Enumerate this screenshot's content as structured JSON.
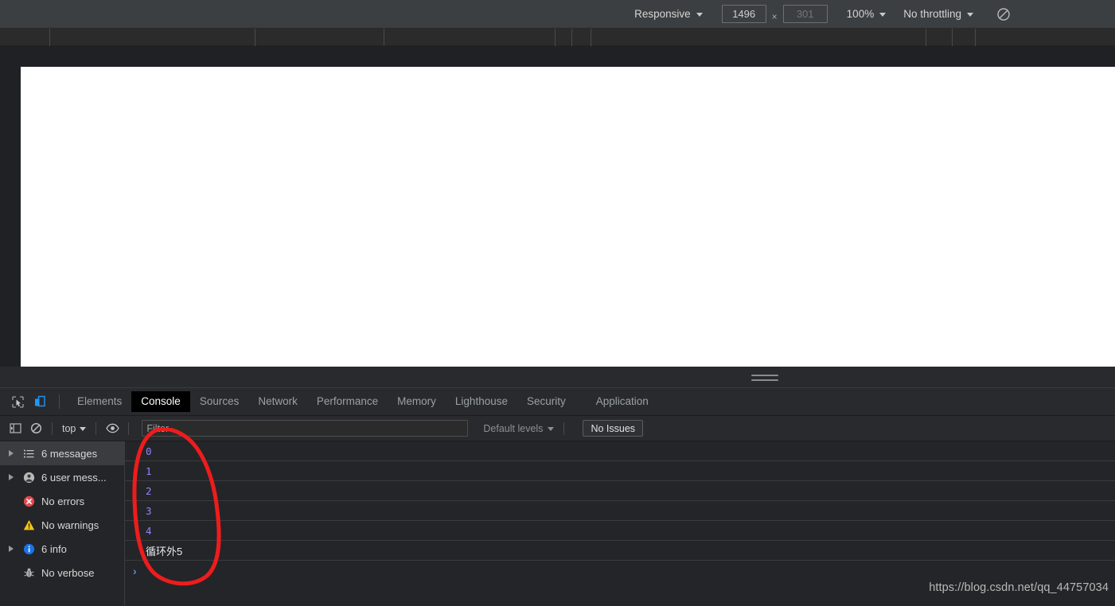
{
  "device_toolbar": {
    "device_select": "Responsive",
    "width_value": "1496",
    "height_placeholder": "301",
    "multiply_symbol": "×",
    "zoom_select": "100%",
    "throttling_select": "No throttling",
    "rotate_icon": "rotate-icon"
  },
  "ruler": {
    "ticks": [
      62,
      320,
      482,
      697,
      718,
      742,
      1163,
      1196,
      1225
    ]
  },
  "tabbar": {
    "inspect_icon": "inspect-cursor-icon",
    "device_toolbar_icon": "device-toolbar-icon",
    "tabs": [
      {
        "label": "Elements",
        "active": false
      },
      {
        "label": "Console",
        "active": true
      },
      {
        "label": "Sources",
        "active": false
      },
      {
        "label": "Network",
        "active": false
      },
      {
        "label": "Performance",
        "active": false
      },
      {
        "label": "Memory",
        "active": false
      },
      {
        "label": "Lighthouse",
        "active": false
      },
      {
        "label": "Security",
        "active": false
      },
      {
        "label": "Application",
        "active": false
      }
    ]
  },
  "filterbar": {
    "sidebar_toggle_icon": "sidebar-toggle-icon",
    "clear_console_icon": "clear-console-icon",
    "context_select": "top",
    "live_expression_icon": "eye-icon",
    "filter_placeholder": "Filter",
    "filter_value": "",
    "levels_select": "Default levels",
    "issues_button": "No Issues"
  },
  "console_sidebar": {
    "items": [
      {
        "label": "6 messages",
        "icon": "list-icon",
        "arrow": true,
        "selected": true
      },
      {
        "label": "6 user mess...",
        "icon": "user-icon",
        "arrow": true,
        "selected": false
      },
      {
        "label": "No errors",
        "icon": "error-icon",
        "arrow": false,
        "selected": false
      },
      {
        "label": "No warnings",
        "icon": "warning-icon",
        "arrow": false,
        "selected": false
      },
      {
        "label": "6 info",
        "icon": "info-icon",
        "arrow": true,
        "selected": false
      },
      {
        "label": "No verbose",
        "icon": "bug-icon",
        "arrow": false,
        "selected": false
      }
    ]
  },
  "console_output": {
    "messages": [
      {
        "text": "0",
        "kind": "num"
      },
      {
        "text": "1",
        "kind": "num"
      },
      {
        "text": "2",
        "kind": "num"
      },
      {
        "text": "3",
        "kind": "num"
      },
      {
        "text": "4",
        "kind": "num"
      },
      {
        "text": "循环外5",
        "kind": "text"
      }
    ],
    "prompt_symbol": "›"
  },
  "annotation": {
    "shape": "hand-drawn-red-ellipse",
    "color": "#ee1c1c"
  },
  "watermark": {
    "text": "https://blog.csdn.net/qq_44757034"
  },
  "colors": {
    "accent_blue": "#4a90e2",
    "number_purple": "#9980ff",
    "error_red": "#e5484d",
    "warning_yellow": "#f5c518",
    "info_blue": "#1a73e8",
    "annotation_red": "#ee1c1c",
    "toolbar_bg": "#3c3f41",
    "panel_bg": "#242528"
  }
}
